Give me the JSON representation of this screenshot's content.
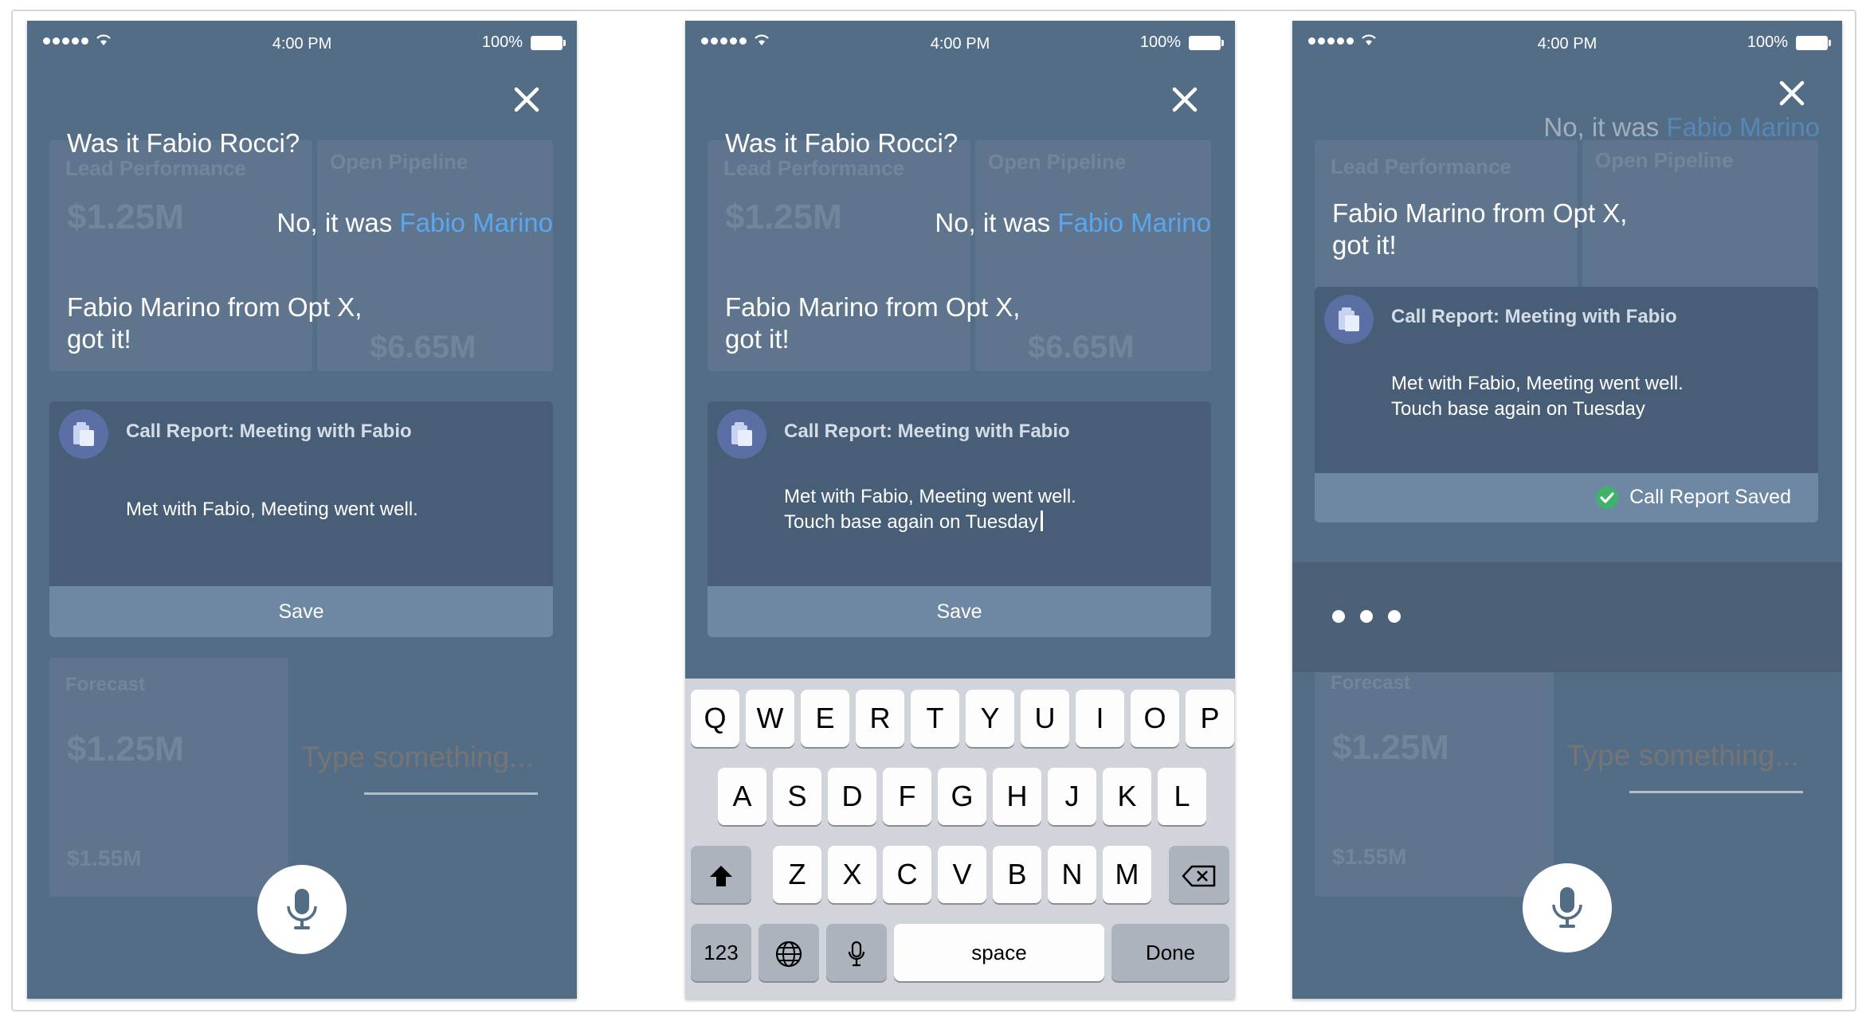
{
  "status_bar": {
    "time": "4:00 PM",
    "battery": "100%"
  },
  "conversation": {
    "question": "Was it Fabio Rocci?",
    "reply_prefix": "No, it was",
    "reply_name": "Fabio Marino",
    "confirmation_line1": "Fabio Marino from Opt X,",
    "confirmation_line2": "got it!"
  },
  "call_report": {
    "title": "Call Report: Meeting with Fabio",
    "body_line1": "Met with Fabio, Meeting went well.",
    "body_line2": "Touch base again on Tuesday",
    "save_label": "Save",
    "saved_label": "Call Report Saved"
  },
  "input": {
    "placeholder": "Type something..."
  },
  "background_dashboard": {
    "card1_title": "Lead Performance",
    "card2_title": "Open Pipeline",
    "amount1": "$1.25M",
    "amount2": "$6.65M",
    "forecast_title": "Forecast",
    "forecast_amount": "$1.25M",
    "forecast_amount2": "$1.55M"
  },
  "keyboard": {
    "row1": [
      "Q",
      "W",
      "E",
      "R",
      "T",
      "Y",
      "U",
      "I",
      "O",
      "P"
    ],
    "row2": [
      "A",
      "S",
      "D",
      "F",
      "G",
      "H",
      "J",
      "K",
      "L"
    ],
    "row3": [
      "Z",
      "X",
      "C",
      "V",
      "B",
      "N",
      "M"
    ],
    "numbers_label": "123",
    "space_label": "space",
    "done_label": "Done"
  },
  "colors": {
    "accent_link": "#5aa7f0",
    "success": "#3fb36b",
    "phone_bg": "#546d86"
  },
  "icons": [
    "wifi-icon",
    "battery-icon",
    "close-icon",
    "report-icon",
    "mic-icon",
    "shift-icon",
    "backspace-icon",
    "globe-icon",
    "check-icon"
  ]
}
